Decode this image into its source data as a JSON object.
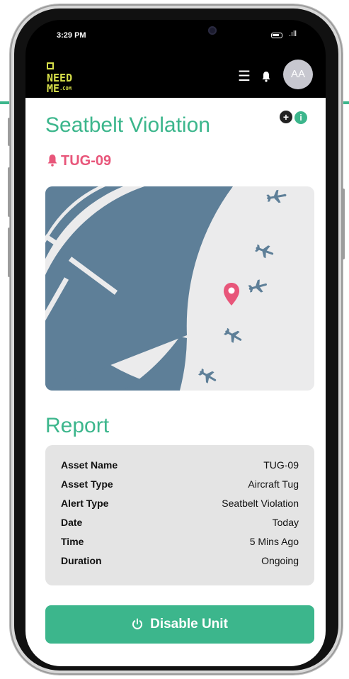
{
  "status_bar": {
    "time": "3:29 PM",
    "signal": ".ıll"
  },
  "header": {
    "logo_line1": "NEED",
    "logo_line2": "ME",
    "logo_com": ".COM",
    "avatar_initials": "AA",
    "icons": [
      "menu-icon",
      "bell-icon"
    ]
  },
  "alert": {
    "title": "Seatbelt Violation",
    "asset_id": "TUG-09"
  },
  "map": {
    "icons": [
      "airplane-icon",
      "location-pin-icon"
    ]
  },
  "report": {
    "title": "Report",
    "rows": [
      {
        "key": "Asset Name",
        "value": "TUG-09"
      },
      {
        "key": "Asset Type",
        "value": "Aircraft Tug"
      },
      {
        "key": "Alert Type",
        "value": "Seatbelt Violation"
      },
      {
        "key": "Date",
        "value": "Today"
      },
      {
        "key": "Time",
        "value": "5 Mins Ago"
      },
      {
        "key": "Duration",
        "value": "Ongoing"
      }
    ]
  },
  "actions": {
    "disable_label": "Disable Unit"
  },
  "colors": {
    "brand_green": "#3cb68c",
    "alert_pink": "#e8567a",
    "map_blue": "#5e7f98",
    "logo_yellow": "#d8e04a"
  }
}
